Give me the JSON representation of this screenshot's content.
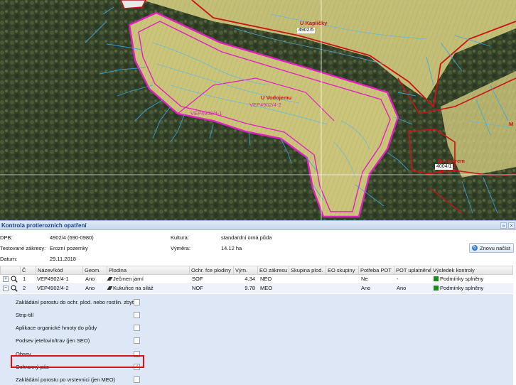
{
  "map": {
    "labels": {
      "u_kaplicky": "U Kapličky",
      "parcel_4902_5": "4902/5",
      "u_vodojemu": "U Vodojemu",
      "vep_4902_4_2": "VEP4902/4-2",
      "vep_4902_4_1": "VEP4902/4-1",
      "parcel_4004_1": "4004/1",
      "za_dvorem": "Za dvorem",
      "m_edge": "M"
    }
  },
  "panel": {
    "title": "Kontrola protierozních opatření",
    "tools": [
      "»",
      "×"
    ],
    "info": {
      "dpb_label": "DPB:",
      "dpb_value": "4902/4 (690-0980)",
      "test_label": "Testované zákresy:",
      "test_value": "Erozní pozemky",
      "date_label": "Datum:",
      "date_value": "29.11.2018",
      "kultura_label": "Kultura:",
      "kultura_value": "standardní orná půda",
      "vymera_label": "Výměra:",
      "vymera_value": "14.12 ha"
    },
    "reload_button": "Znovu načíst"
  },
  "grid": {
    "columns": [
      "Č",
      "Název/kód",
      "Geom.",
      "Plodina",
      "Ochr. fce plodiny",
      "Vým.",
      "EO zákresu",
      "Skupina plod.",
      "EO skupiny",
      "Potřeba POT",
      "POT uplatněné",
      "Výsledek kontroly"
    ],
    "rows": [
      {
        "expander": "+",
        "n": "1",
        "name": "VEP4902/4-1",
        "geom": "Ano",
        "crop": "Ječmen jarní",
        "fce": "SOF",
        "vym": "4.34",
        "eo": "NEO",
        "skupina": "",
        "eo_sk": "",
        "potreba": "Ne",
        "uplatnene": "-",
        "result": "Podmínky splněny"
      },
      {
        "expander": "−",
        "n": "2",
        "name": "VEP4902/4-2",
        "geom": "Ano",
        "crop": "Kukuřice na siláž",
        "fce": "NOF",
        "vym": "9.78",
        "eo": "MEO",
        "skupina": "",
        "eo_sk": "",
        "potreba": "Ano",
        "uplatnene": "Ano",
        "result": "Podmínky splněny"
      }
    ],
    "measures": [
      {
        "label": "Zakládání porostu do ochr. plod. nebo rostlin. zbytků",
        "checked": false
      },
      {
        "label": "Strip-till",
        "checked": false
      },
      {
        "label": "Aplikace organické hmoty do půdy",
        "checked": false
      },
      {
        "label": "Podsev jetelovin/trav (jen SEO)",
        "checked": false
      },
      {
        "label": "Obsev",
        "checked": false
      },
      {
        "label": "Ochranný pás",
        "checked": true
      },
      {
        "label": "Zakládání porostu po vrstevnici (jen MEO)",
        "checked": false
      }
    ]
  },
  "colors": {
    "accent_border": "#99bbe8",
    "status_green": "#1e8a1e",
    "highlight_red": "#e01010",
    "parcel_magenta": "#e020c0",
    "field_yellow": "#c9c47a"
  }
}
